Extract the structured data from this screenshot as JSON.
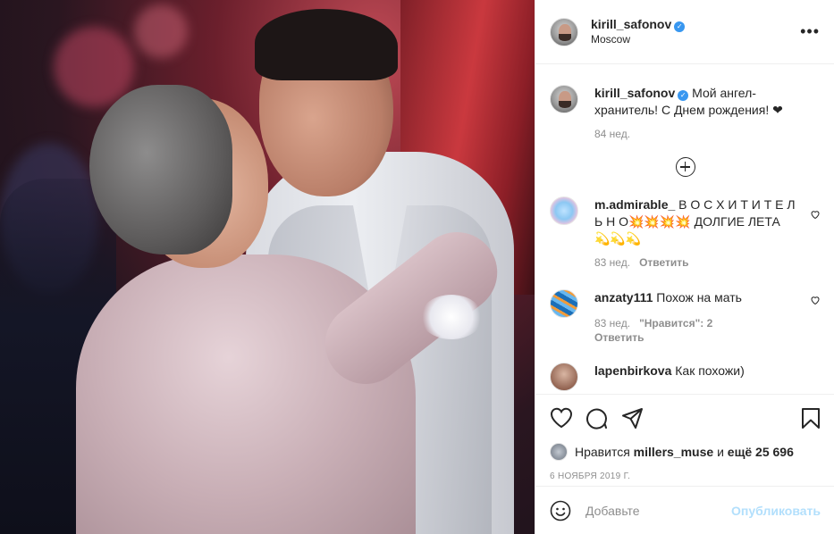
{
  "post": {
    "author": {
      "username": "kirill_safonov",
      "verified": true,
      "location": "Moscow"
    },
    "caption": {
      "username": "kirill_safonov",
      "text": "Мой ангел-хранитель! С Днем рождения! ❤",
      "time": "84 нед."
    },
    "comments": [
      {
        "username": "m.admirable_",
        "text": "В О С Х И Т И Т Е Л Ь Н О💥💥💥💥 ДОЛГИЕ ЛЕТА 💫💫💫",
        "time": "83 нед.",
        "likes": "",
        "reply_label": "Ответить"
      },
      {
        "username": "anzaty111",
        "text": "Похож на мать",
        "time": "83 нед.",
        "likes": "\"Нравится\": 2",
        "reply_label": "Ответить"
      },
      {
        "username": "lapenbirkova",
        "text": "Как похожи)",
        "time": "",
        "likes": "",
        "reply_label": ""
      }
    ],
    "likes": {
      "prefix": "Нравится",
      "user": "millers_muse",
      "conjunction": "и",
      "count_text": "ещё 25 696"
    },
    "date": "6 НОЯБРЯ 2019 Г.",
    "add_comment": {
      "placeholder": "Добавьте",
      "publish_label": "Опубликовать"
    }
  },
  "icons": {
    "more": "more-options-icon",
    "load_more": "plus-circle-icon",
    "like": "heart-icon",
    "comment": "comment-icon",
    "share": "paper-plane-icon",
    "save": "bookmark-icon",
    "emoji": "smiley-icon"
  },
  "colors": {
    "text": "#262626",
    "muted": "#8e8e8e",
    "verified": "#3897f0",
    "publish_disabled": "#b2dffc",
    "divider": "#efefef"
  }
}
